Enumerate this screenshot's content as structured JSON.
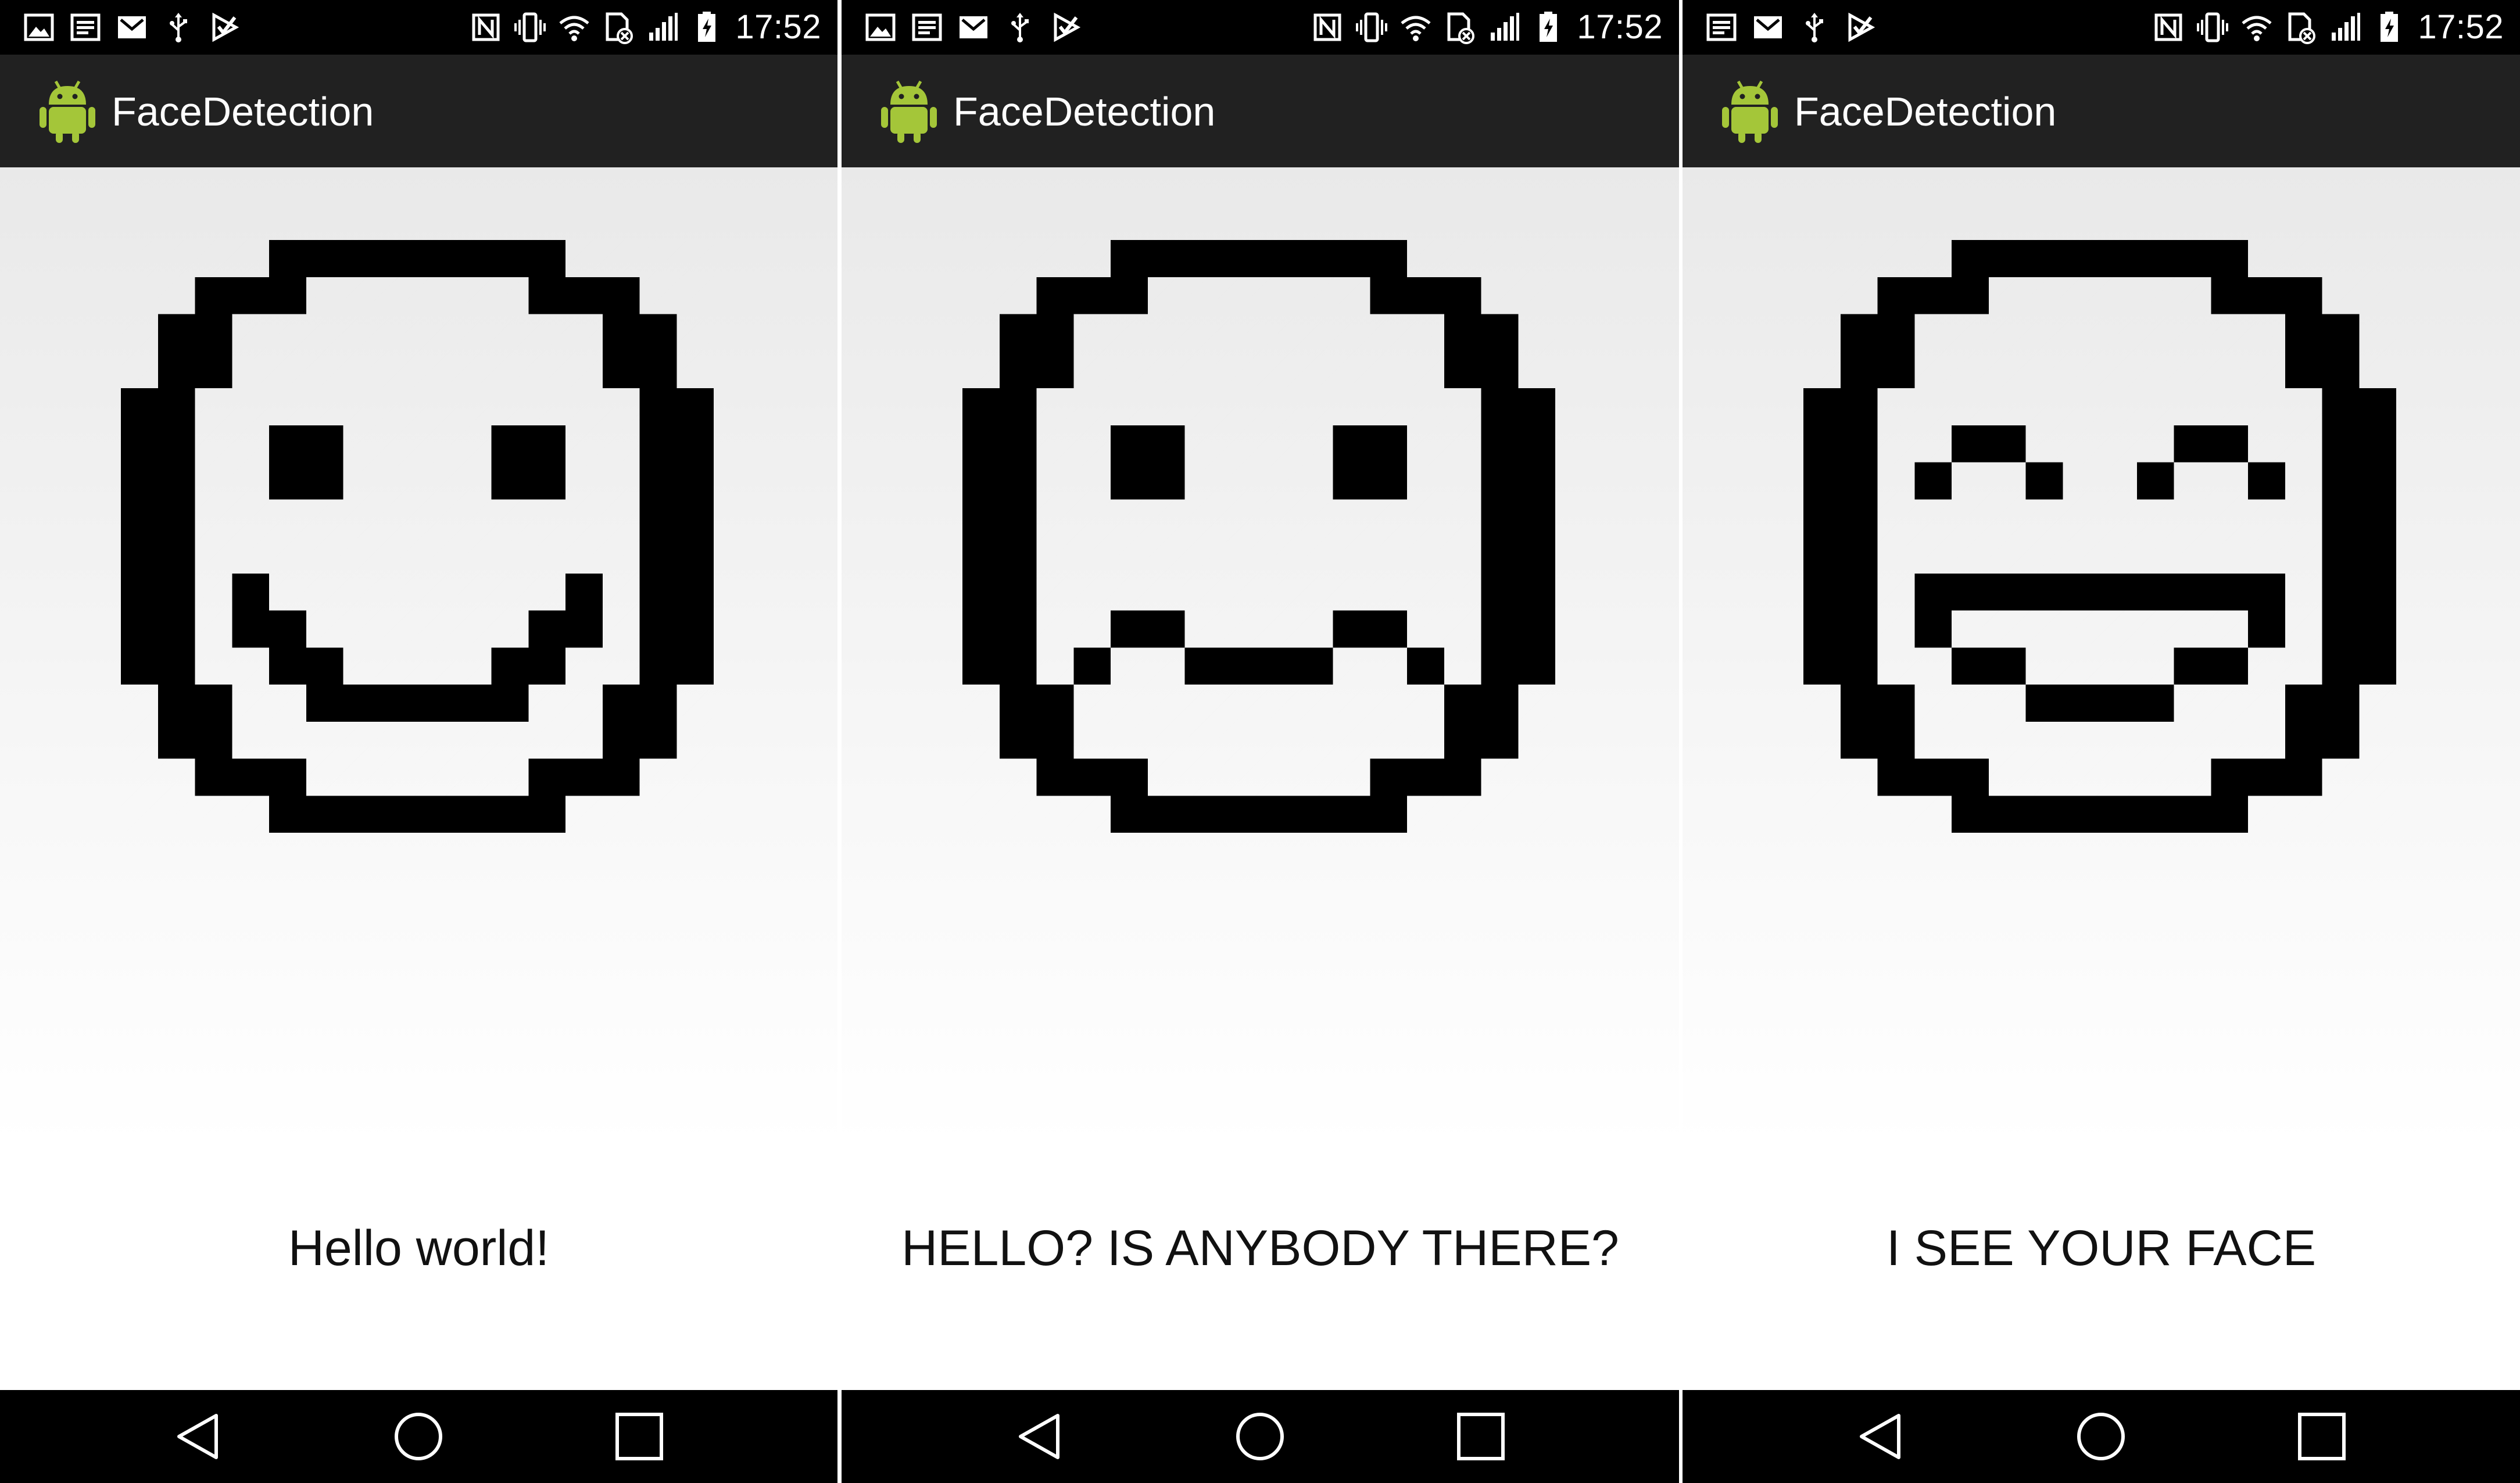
{
  "colors": {
    "status_bar": "#000000",
    "action_bar": "#212121",
    "nav_bar": "#000000",
    "android_green": "#a4c639",
    "face_ink": "#000000",
    "message_text": "#111111"
  },
  "screens": [
    {
      "status": {
        "icons": [
          "photo-icon",
          "notes-icon",
          "gmail-icon",
          "usb-icon",
          "play-store-icon",
          "nfc-icon",
          "vibrate-icon",
          "wifi-icon",
          "no-sim-icon",
          "signal-icon",
          "battery-charging-icon"
        ],
        "time": "17:52"
      },
      "app": {
        "title": "FaceDetection",
        "icon": "android-robot-icon"
      },
      "face": {
        "expression": "smile",
        "icon": "pixel-smiley-icon"
      },
      "message": "Hello world!",
      "nav": {
        "back_icon": "back-triangle-icon",
        "home_icon": "home-circle-icon",
        "recent_icon": "recent-apps-square-icon"
      }
    },
    {
      "status": {
        "icons": [
          "photo-icon",
          "notes-icon",
          "gmail-icon",
          "usb-icon",
          "play-store-icon",
          "nfc-icon",
          "vibrate-icon",
          "wifi-icon",
          "no-sim-icon",
          "signal-icon",
          "battery-charging-icon"
        ],
        "time": "17:52"
      },
      "app": {
        "title": "FaceDetection",
        "icon": "android-robot-icon"
      },
      "face": {
        "expression": "unsure",
        "icon": "pixel-unsure-face-icon"
      },
      "message": "HELLO? IS ANYBODY THERE?",
      "nav": {
        "back_icon": "back-triangle-icon",
        "home_icon": "home-circle-icon",
        "recent_icon": "recent-apps-square-icon"
      }
    },
    {
      "status": {
        "icons": [
          "notes-icon",
          "gmail-icon",
          "usb-icon",
          "play-store-icon",
          "nfc-icon",
          "vibrate-icon",
          "wifi-icon",
          "no-sim-icon",
          "signal-icon",
          "battery-charging-icon"
        ],
        "time": "17:52"
      },
      "app": {
        "title": "FaceDetection",
        "icon": "android-robot-icon"
      },
      "face": {
        "expression": "grin",
        "icon": "pixel-grin-face-icon"
      },
      "message": "I SEE YOUR FACE",
      "nav": {
        "back_icon": "back-triangle-icon",
        "home_icon": "home-circle-icon",
        "recent_icon": "recent-apps-square-icon"
      }
    }
  ]
}
